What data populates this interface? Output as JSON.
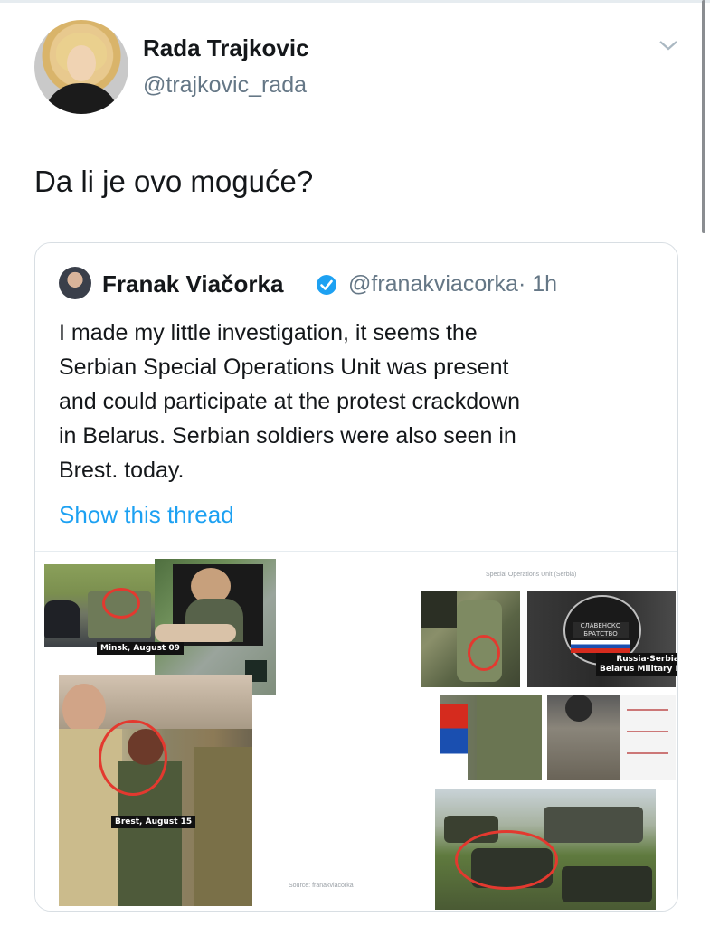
{
  "tweet": {
    "author_name": "Rada Trajkovic",
    "author_handle": "@trajkovic_rada",
    "text": "Da li je ovo moguće?"
  },
  "quoted_tweet": {
    "author_name": "Franak Viačorka",
    "author_handle": "@franakviacorka",
    "time": "· 1h",
    "verified": true,
    "body_lines": [
      "I made my little investigation, it seems the",
      "Serbian Special Operations Unit was present",
      "and could participate at the protest crackdown",
      "in Belarus. Serbian soldiers were also seen in",
      "Brest. today."
    ],
    "show_thread": "Show this thread",
    "media": {
      "caption_minsk": "Minsk, August 09",
      "caption_brest": "Brest, August 15",
      "caption_drills_1": "Russia-Serbia-",
      "caption_drills_2": "Belarus Military Drills",
      "header_small": "Special Operations Unit (Serbia)",
      "watermark": "Source: franakviacorka",
      "badge_text_1": "СЛАВЕНСКО",
      "badge_text_2": "БРАТСТВО"
    }
  },
  "colors": {
    "link": "#1da1f2",
    "secondary_text": "#657786",
    "verified": "#1da1f2",
    "highlight_ring": "#e3392f"
  },
  "icons": [
    "chevron-down-icon",
    "verified-badge-icon"
  ]
}
